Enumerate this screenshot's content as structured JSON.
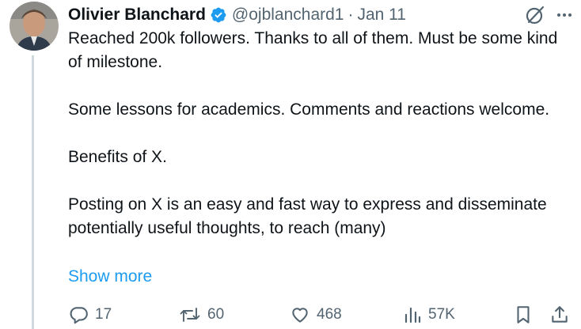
{
  "tweet": {
    "author_name": "Olivier Blanchard",
    "handle": "@ojblanchard1",
    "separator": "·",
    "date": "Jan 11",
    "paragraphs": [
      "Reached 200k followers. Thanks to all of them.  Must be some kind of milestone.",
      "Some lessons for academics.  Comments and reactions welcome.",
      "Benefits of X.",
      "Posting on X is an easy and fast way to express and disseminate potentially useful thoughts, to reach (many)"
    ],
    "show_more_label": "Show more"
  },
  "actions": {
    "replies": "17",
    "reposts": "60",
    "likes": "468",
    "views": "57K"
  },
  "icons": {
    "verified": "verified-badge-icon",
    "grok": "grok-icon",
    "more": "more-icon",
    "reply": "reply-icon",
    "repost": "repost-icon",
    "like": "heart-icon",
    "views": "views-icon",
    "bookmark": "bookmark-icon",
    "share": "share-icon"
  },
  "colors": {
    "text": "#0f1419",
    "secondary": "#536471",
    "link": "#1d9bf0",
    "verified": "#1d9bf0",
    "thread_line": "#cfd9de"
  }
}
